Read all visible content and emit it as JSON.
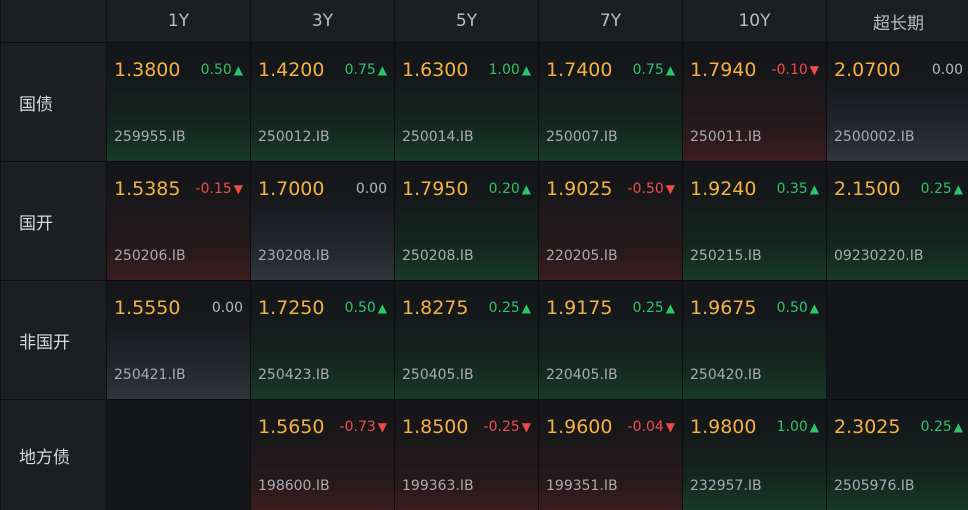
{
  "columns": [
    "1Y",
    "3Y",
    "5Y",
    "7Y",
    "10Y",
    "超长期"
  ],
  "rows": [
    {
      "label": "国债",
      "cells": [
        {
          "price": "1.3800",
          "change": "0.50",
          "dir": "up",
          "code": "259955.IB"
        },
        {
          "price": "1.4200",
          "change": "0.75",
          "dir": "up",
          "code": "250012.IB"
        },
        {
          "price": "1.6300",
          "change": "1.00",
          "dir": "up",
          "code": "250014.IB"
        },
        {
          "price": "1.7400",
          "change": "0.75",
          "dir": "up",
          "code": "250007.IB"
        },
        {
          "price": "1.7940",
          "change": "-0.10",
          "dir": "down",
          "code": "250011.IB"
        },
        {
          "price": "2.0700",
          "change": "0.00",
          "dir": "flat",
          "code": "2500002.IB"
        }
      ]
    },
    {
      "label": "国开",
      "cells": [
        {
          "price": "1.5385",
          "change": "-0.15",
          "dir": "down",
          "code": "250206.IB"
        },
        {
          "price": "1.7000",
          "change": "0.00",
          "dir": "flat",
          "code": "230208.IB"
        },
        {
          "price": "1.7950",
          "change": "0.20",
          "dir": "up",
          "code": "250208.IB"
        },
        {
          "price": "1.9025",
          "change": "-0.50",
          "dir": "down",
          "code": "220205.IB"
        },
        {
          "price": "1.9240",
          "change": "0.35",
          "dir": "up",
          "code": "250215.IB"
        },
        {
          "price": "2.1500",
          "change": "0.25",
          "dir": "up",
          "code": "09230220.IB"
        }
      ]
    },
    {
      "label": "非国开",
      "cells": [
        {
          "price": "1.5550",
          "change": "0.00",
          "dir": "flat",
          "code": "250421.IB"
        },
        {
          "price": "1.7250",
          "change": "0.50",
          "dir": "up",
          "code": "250423.IB"
        },
        {
          "price": "1.8275",
          "change": "0.25",
          "dir": "up",
          "code": "250405.IB"
        },
        {
          "price": "1.9175",
          "change": "0.25",
          "dir": "up",
          "code": "220405.IB"
        },
        {
          "price": "1.9675",
          "change": "0.50",
          "dir": "up",
          "code": "250420.IB"
        },
        null
      ]
    },
    {
      "label": "地方债",
      "cells": [
        null,
        {
          "price": "1.5650",
          "change": "-0.73",
          "dir": "down",
          "code": "198600.IB"
        },
        {
          "price": "1.8500",
          "change": "-0.25",
          "dir": "down",
          "code": "199363.IB"
        },
        {
          "price": "1.9600",
          "change": "-0.04",
          "dir": "down",
          "code": "199351.IB"
        },
        {
          "price": "1.9800",
          "change": "1.00",
          "dir": "up",
          "code": "232957.IB"
        },
        {
          "price": "2.3025",
          "change": "0.25",
          "dir": "up",
          "code": "2505976.IB"
        }
      ]
    }
  ],
  "colors": {
    "price": "#f5b043",
    "up": "#2cc46a",
    "down": "#f04a4a",
    "flat": "#b5b8bd"
  },
  "icons": {
    "up": "triangle-up-icon",
    "down": "triangle-down-icon"
  }
}
